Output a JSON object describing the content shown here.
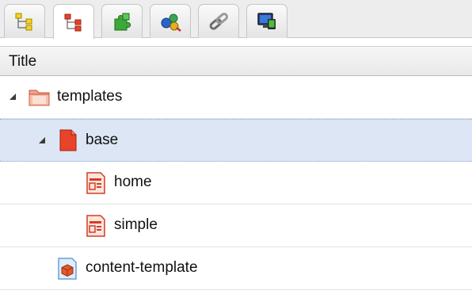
{
  "toolbar": {
    "tabs": [
      {
        "icon": "tree-yellow-icon",
        "active": false
      },
      {
        "icon": "tree-red-icon",
        "active": true
      },
      {
        "icon": "puzzle-icon",
        "active": false
      },
      {
        "icon": "components-icon",
        "active": false
      },
      {
        "icon": "link-icon",
        "active": false
      },
      {
        "icon": "devices-icon",
        "active": false
      }
    ]
  },
  "table": {
    "header_title": "Title",
    "rows": [
      {
        "label": "templates",
        "icon": "folder-icon",
        "expanded": true,
        "level": 0
      },
      {
        "label": "base",
        "icon": "template-base-icon",
        "expanded": true,
        "level": 1,
        "selected": true
      },
      {
        "label": "home",
        "icon": "page-template-icon",
        "level": 2
      },
      {
        "label": "simple",
        "icon": "page-template-icon",
        "level": 2
      },
      {
        "label": "content-template",
        "icon": "content-cube-icon",
        "level": 1
      }
    ]
  },
  "colors": {
    "selection": "#dce6f5",
    "header_bg": "#ececec",
    "template_red": "#e8442a"
  }
}
